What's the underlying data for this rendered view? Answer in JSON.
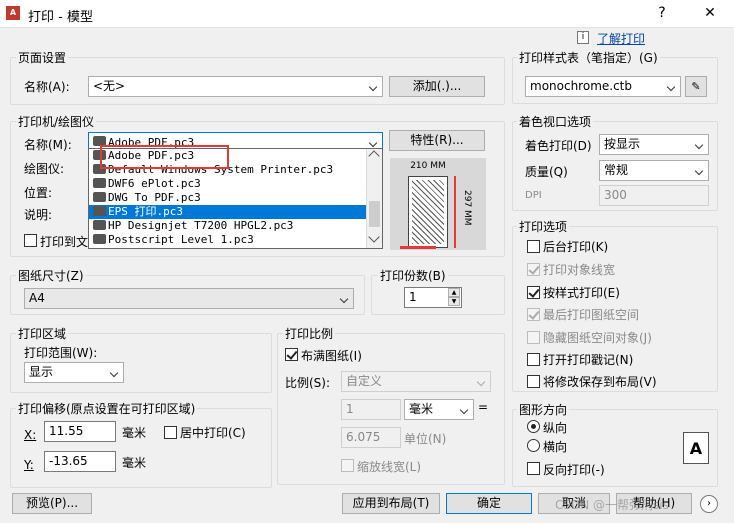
{
  "window": {
    "title": "打印 - 模型",
    "help": "?",
    "close": "✕"
  },
  "help_link": "了解打印",
  "page_setup": {
    "title": "页面设置",
    "name_label": "名称(A):",
    "name_value": "<无>",
    "add_button": "添加(.)..."
  },
  "printer": {
    "title": "打印机/绘图仪",
    "name_label": "名称(M):",
    "name_value": "Adobe PDF.pc3",
    "properties_button": "特性(R)...",
    "plotter_label": "绘图仪:",
    "location_label": "位置:",
    "description_label": "说明:",
    "print_to_file": "打印到文",
    "dropdown_items": [
      "Adobe PDF.pc3",
      "Default Windows System Printer.pc3",
      "DWF6 ePlot.pc3",
      "DWG To PDF.pc3",
      "EPS 打印.pc3",
      "HP Designjet T7200 HPGL2.pc3",
      "Postscript Level 1.pc3"
    ],
    "selected_index": 4
  },
  "preview": {
    "width_label": "210 MM",
    "height_label": "297 MM"
  },
  "paper_size": {
    "title": "图纸尺寸(Z)",
    "value": "A4"
  },
  "copies": {
    "title": "打印份数(B)",
    "value": "1"
  },
  "print_area": {
    "title": "打印区域",
    "range_label": "打印范围(W):",
    "range_value": "显示"
  },
  "offset": {
    "title": "打印偏移(原点设置在可打印区域)",
    "x_label": "X:",
    "x_value": "11.55",
    "x_unit": "毫米",
    "y_label": "Y:",
    "y_value": "-13.65",
    "y_unit": "毫米",
    "center": "居中打印(C)"
  },
  "scale": {
    "title": "打印比例",
    "fit": "布满图纸(I)",
    "ratio_label": "比例(S):",
    "ratio_value": "自定义",
    "val1": "1",
    "unit_value": "毫米",
    "eq": "=",
    "val2": "6.075",
    "unit_label": "单位(N)",
    "lineweights": "缩放线宽(L)"
  },
  "style_table": {
    "title": "打印样式表（笔指定）(G)",
    "value": "monochrome.ctb"
  },
  "shaded": {
    "title": "着色视口选项",
    "shade_label": "着色打印(D)",
    "shade_value": "按显示",
    "quality_label": "质量(Q)",
    "quality_value": "常规",
    "dpi_label": "DPI",
    "dpi_value": "300"
  },
  "options": {
    "title": "打印选项",
    "items": [
      {
        "label": "后台打印(K)",
        "checked": false,
        "disabled": false
      },
      {
        "label": "打印对象线宽",
        "checked": true,
        "disabled": true
      },
      {
        "label": "按样式打印(E)",
        "checked": true,
        "disabled": false
      },
      {
        "label": "最后打印图纸空间",
        "checked": true,
        "disabled": true
      },
      {
        "label": "隐藏图纸空间对象(J)",
        "checked": false,
        "disabled": true
      },
      {
        "label": "打开打印戳记(N)",
        "checked": false,
        "disabled": false
      },
      {
        "label": "将修改保存到布局(V)",
        "checked": false,
        "disabled": false
      }
    ]
  },
  "orientation": {
    "title": "图形方向",
    "portrait": "纵向",
    "landscape": "横向",
    "reverse": "反向打印(-)",
    "icon_letter": "A"
  },
  "footer": {
    "preview": "预览(P)...",
    "apply": "应用到布局(T)",
    "ok": "确定",
    "cancel": "取消",
    "help": "帮助(H)",
    "watermark": "CSDN @一帮弥刑sis"
  }
}
